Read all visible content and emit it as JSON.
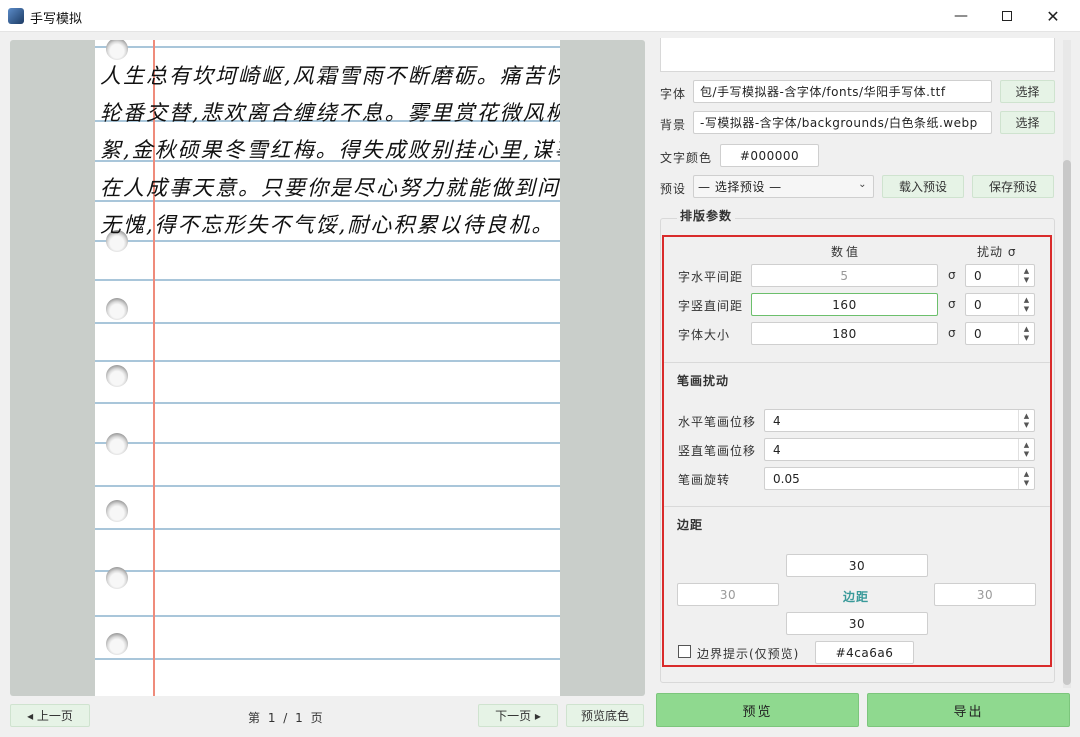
{
  "window": {
    "title": "手写模拟"
  },
  "preview": {
    "handwriting_lines": [
      "人生总有坎坷崎岖,风霜雪雨不断磨砺。痛苦快乐",
      "轮番交替,悲欢离合缠绕不息。雾里赏花微风柳",
      "絮,金秋硕果冬雪红梅。得失成败别挂心里,谋事",
      "在人成事天意。只要你是尽心努力就能做到问心",
      "无愧,得不忘形失不气馁,耐心积累以待良机。"
    ],
    "prev_label": "◂ 上一页",
    "page_info": "第 1 / 1 页",
    "next_label": "下一页 ▸",
    "bg_preview_label": "预览底色"
  },
  "settings": {
    "font_label": "字体",
    "font_path": "包/手写模拟器-含字体/fonts/华阳手写体.ttf",
    "bg_label": "背景",
    "bg_path": "-写模拟器-含字体/backgrounds/白色条纸.webp",
    "choose_label": "选择",
    "color_label": "文字颜色",
    "color_value": "#000000",
    "preset_label": "预设",
    "preset_value": "— 选择预设 —",
    "load_preset": "载入预设",
    "save_preset": "保存预设"
  },
  "layout_params": {
    "title": "排版参数",
    "col_value": "数值",
    "col_jitter": "扰动 σ",
    "sigma": "σ",
    "rows": [
      {
        "label": "字水平间距",
        "value": "5",
        "jitter": "0"
      },
      {
        "label": "字竖直间距",
        "value": "160",
        "jitter": "0"
      },
      {
        "label": "字体大小",
        "value": "180",
        "jitter": "0"
      }
    ]
  },
  "stroke": {
    "title": "笔画扰动",
    "rows": [
      {
        "label": "水平笔画位移",
        "value": "4"
      },
      {
        "label": "竖直笔画位移",
        "value": "4"
      },
      {
        "label": "笔画旋转",
        "value": "0.05"
      }
    ]
  },
  "margins": {
    "title": "边距",
    "top": "30",
    "left": "30",
    "center_label": "边距",
    "right": "30",
    "bottom": "30",
    "hint_label": "边界提示(仅预览)",
    "hint_color": "#4ca6a6"
  },
  "actions": {
    "preview": "预览",
    "export": "导出"
  },
  "colors": {
    "accent_green": "#8fd98f",
    "highlight_red": "#d92b2b",
    "paper_rule": "#a9c6da",
    "margin_red": "#ef8b7b"
  }
}
